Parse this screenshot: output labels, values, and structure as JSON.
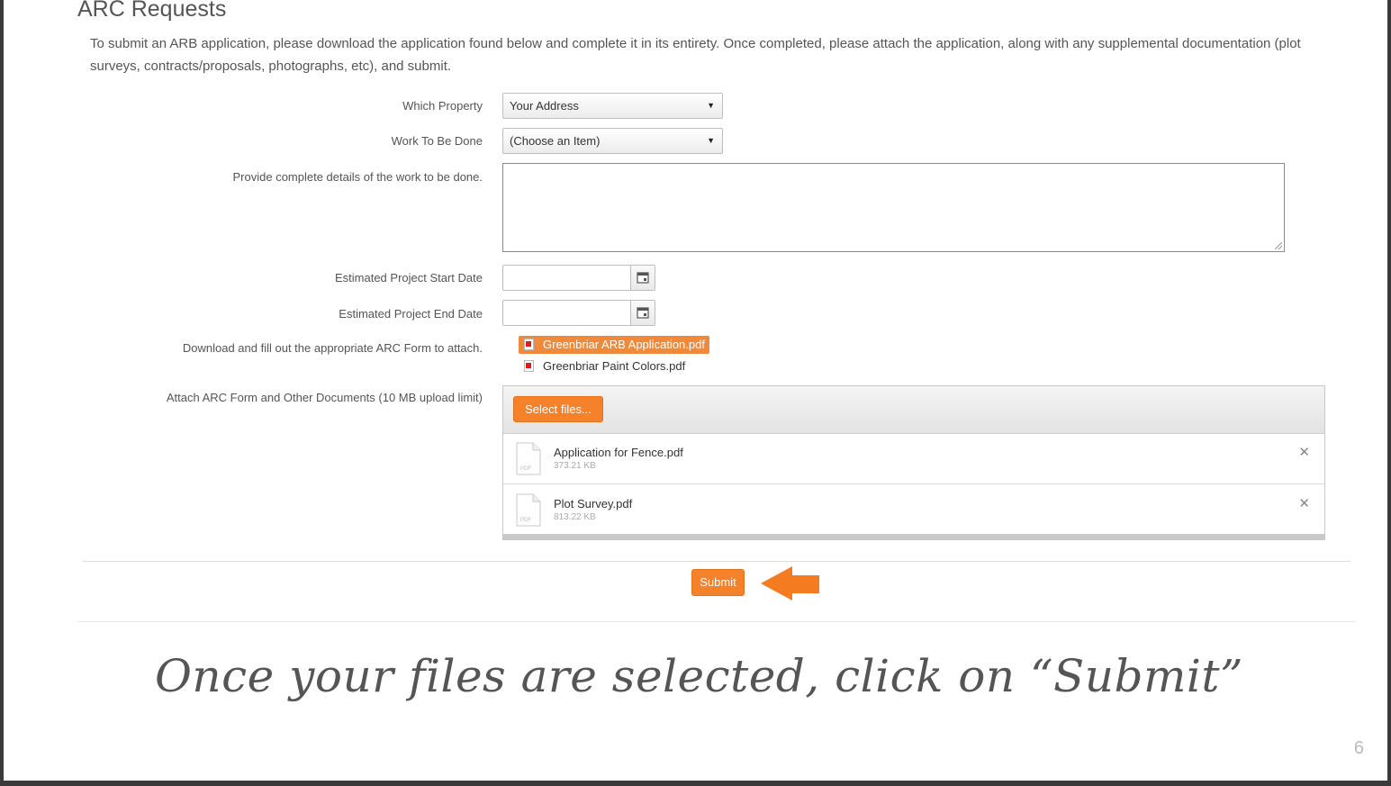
{
  "page": {
    "title": "ARC Requests",
    "intro": "To submit an ARB application, please download the application found below and complete it in its entirety. Once completed, please attach the application, along with any supplemental documentation (plot surveys, contracts/proposals, photographs, etc), and submit."
  },
  "form": {
    "property_label": "Which Property",
    "property_value": "Your Address",
    "work_label": "Work To Be Done",
    "work_value": "(Choose an Item)",
    "details_label": "Provide complete details of the work to be done.",
    "details_value": "",
    "start_label": "Estimated Project Start Date",
    "start_value": "",
    "end_label": "Estimated Project End Date",
    "end_value": "",
    "download_label": "Download and fill out the appropriate ARC Form to attach.",
    "downloads": [
      "Greenbriar ARB Application.pdf",
      "Greenbriar Paint Colors.pdf"
    ],
    "attach_label": "Attach ARC Form and Other Documents (10 MB upload limit)",
    "select_files_label": "Select files...",
    "files": [
      {
        "name": "Application for Fence.pdf",
        "size": "373.21 KB",
        "type": "PDF"
      },
      {
        "name": "Plot Survey.pdf",
        "size": "813.22 KB",
        "type": "PDF"
      }
    ],
    "submit_label": "Submit"
  },
  "slide": {
    "caption": "Once your files are selected, click on “Submit”",
    "page_number": "6"
  },
  "colors": {
    "accent": "#f5822a",
    "arrow": "#f47b20"
  },
  "icons": {
    "dropdown": "caret-down-icon",
    "calendar": "calendar-icon",
    "pdf": "pdf-icon",
    "remove": "close-icon",
    "arrow": "arrow-left-icon"
  }
}
